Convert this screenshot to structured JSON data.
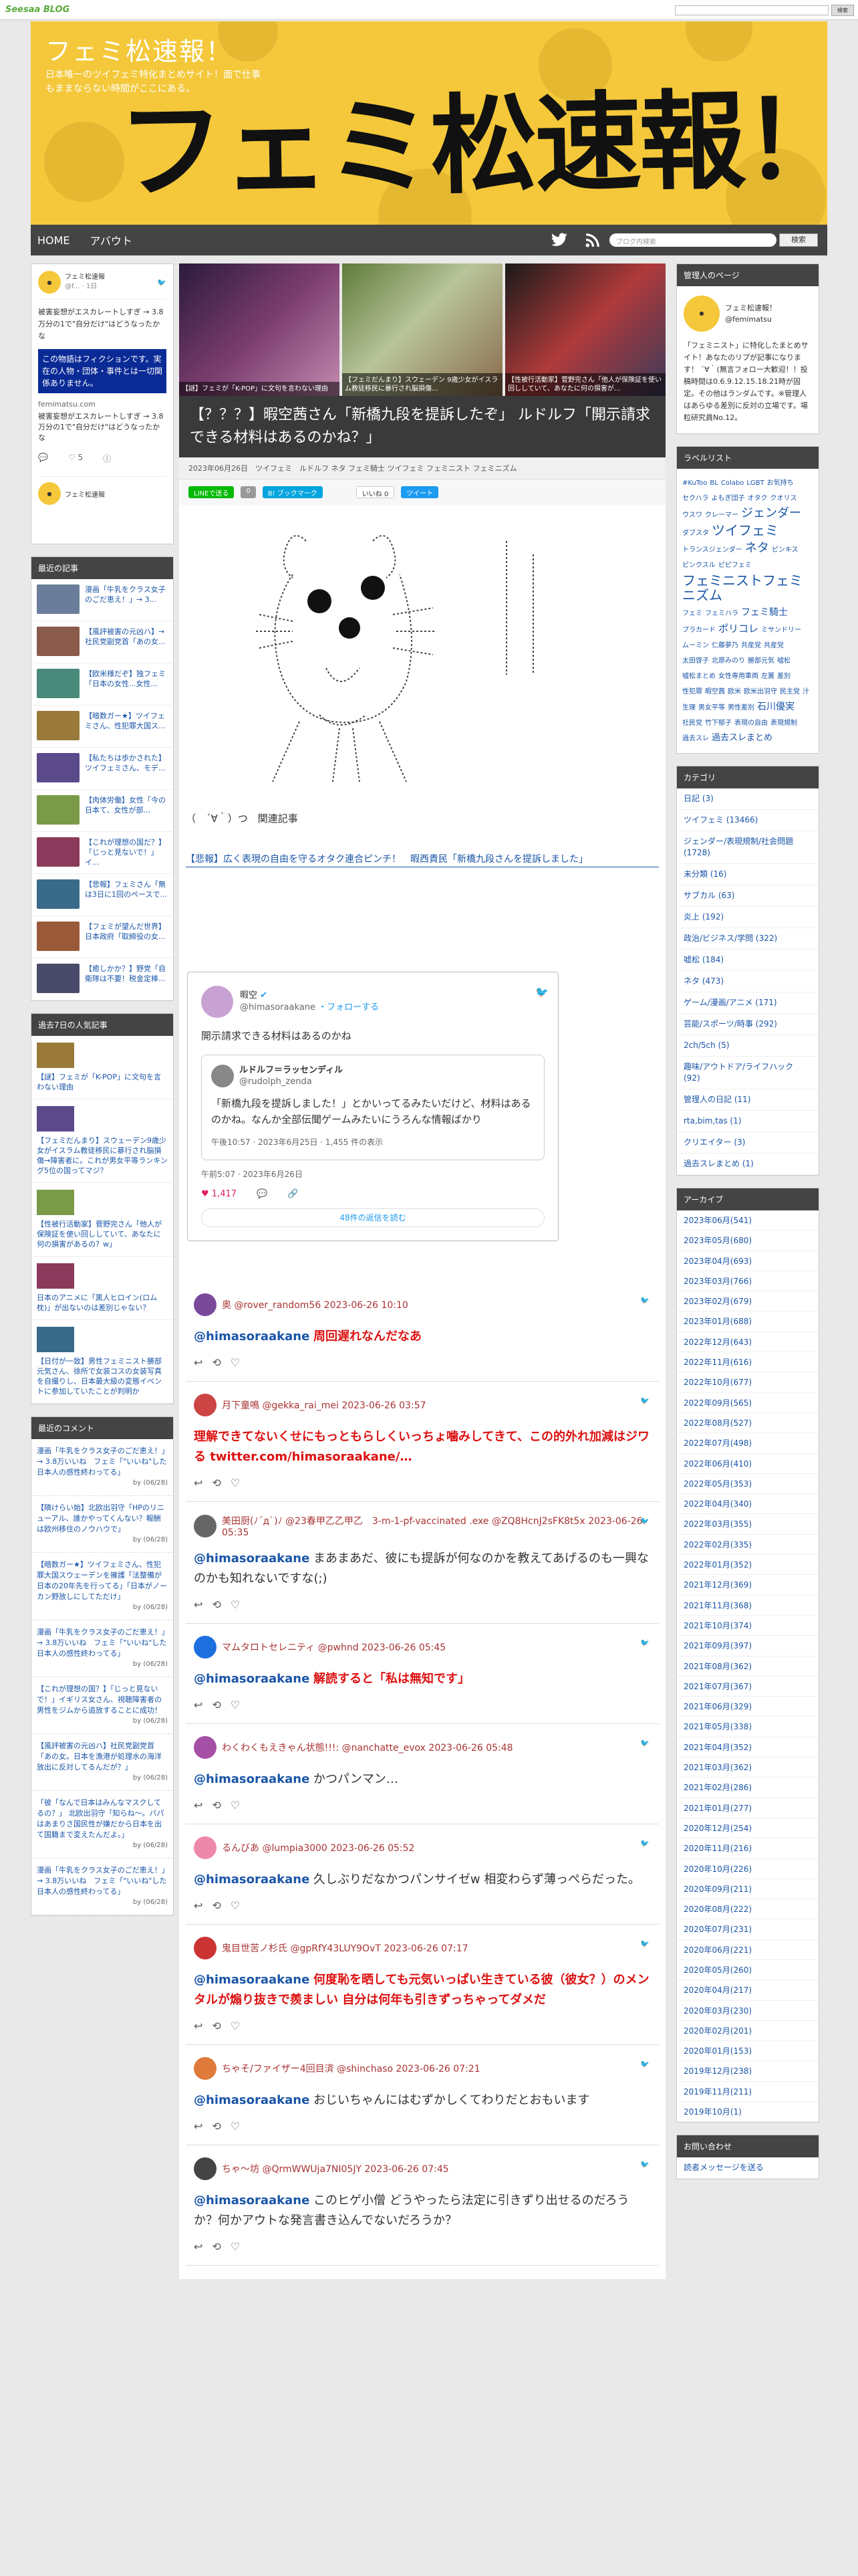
{
  "topbar": {
    "logo": "Seesaa",
    "logo_blog": "BLOG",
    "search_button": "検索"
  },
  "header": {
    "title": "フェミ松速報！",
    "description": "日本唯一のツイフェミ特化まとめサイト！面で仕事もままならない時間がここにある。",
    "logo_text": "フェミ松速報！"
  },
  "nav": {
    "items": [
      "HOME",
      "アバウト"
    ],
    "search_placeholder": "ブログ内検索",
    "search_button": "検索"
  },
  "left_twitter": {
    "name": "フェミ松速報",
    "meta": "@f... · 1日",
    "text": "被害妄想がエスカレートしすぎ → 3.8万分の1で\"自分だけ\"はどうなったかな",
    "banner": "この物語はフィクションです。実在の人物・団体・事件とは一切関係ありません。",
    "link": "femimatsu.com",
    "link_text": "被害妄想がエスカレートしすぎ → 3.8万分の1で\"自分だけ\"はどうなったかな",
    "likes": "5"
  },
  "recent": {
    "title": "最近の記事",
    "items": [
      "漫画「牛乳をクラス女子のごだ恵え！」→ 3...",
      "【風評被害の元凶ハ】→社民党副党首「あの女...",
      "【欧米様だぞ】独フェミ「日本の女性...女性...",
      "【暗数ガー★】ツイフェミさん、性犯罪大国ス...",
      "【私たちは歩かされた】ツイフェミさん、モデ...",
      "【肉体労働】女性「今の日本て、女性が部...",
      "【これが理想の国だ？】「じっと見ないで！」イ...",
      "【悲報】フェミさん「無は3日に1回のペースで...",
      "【フェミが望んだ世界】日本政府「取締役の女...",
      "【癒しかか？】野党「自衛隊は不要！税金定棒..."
    ]
  },
  "popular": {
    "title": "過去7日の人気記事",
    "items": [
      "【謎】フェミが「K-POP」に文句を言わない理由",
      "【フェミだんまり】スウェーデン9歳少女がイスラム教徒移民に暴行され脳損傷→障害者に。これが男女平等ランキング5位の国ってマジ？",
      "【性被行活動家】菅野完さん「他人が保険証を使い回ししていて、あなたに何の損害があるの？w」",
      "日本のアニメに「黒人ヒロイン(ロム枕)」が出ないのは差別じゃない？",
      "【日付が一致】男性フェミニスト勝部元気さん、徐所で女装コスの女装写真を自撮りし、日本最大級の変態イベントに参加していたことが判明か"
    ]
  },
  "comments": {
    "title": "最近のコメント",
    "items": [
      {
        "text": "漫画「牛乳をクラス女子のごだ恵え！」→ 3.8万いいね　フェミ「\"いいね\"した日本人の感性終わってる」",
        "by": "by (06/28)"
      },
      {
        "text": "【隣けらい始】北欧出羽守「HPのリニューアル、誰かやってくんない？報酬は欧州移住のノウハウで」",
        "by": "by (06/28)"
      },
      {
        "text": "【暗数ガー★】ツイフェミさん、性犯罪大国スウェーデンを擁護「法整備が日本の20年先を行ってる」「日本がノーカン野放しにしてただけ」",
        "by": "by (06/28)"
      },
      {
        "text": "漫画「牛乳をクラス女子のごだ恵え！」→ 3.8万いいね　フェミ「\"いいね\"した日本人の感性終わってる」",
        "by": "by (06/28)"
      },
      {
        "text": "【これが理想の国？】「じっと見ないで！」イギリス女さん、視聴障害者の男性をジムから追放することに成功！",
        "by": "by (06/28)"
      },
      {
        "text": "【風評被害の元凶ハ】社民党副党首「あの女。日本を漁港が処理水の海洋放出に反対してるんだが？」",
        "by": "by (06/28)"
      },
      {
        "text": "「彼「なんで日本はみんなマスクしてるの？」 北欧出羽守「知らね～。バパはあまりさ国民性が嫌だから日本を出て国籍まで変えたんだよ。」",
        "by": "by (06/28)"
      },
      {
        "text": "漫画「牛乳をクラス女子のごだ恵え！」→ 3.8万いいね　フェミ「\"いいね\"した日本人の感性終わってる」",
        "by": "by (06/28)"
      }
    ]
  },
  "featured": [
    "【謎】フェミが「K-POP」に文句を言わない理由",
    "【フェミだんまり】スウェーデン 9歳少女がイスラム教徒移民に暴行され脳損傷…",
    "【性被行活動家】菅野完さん「他人が保険証を使い回ししていて、あなたに何の損害が…"
  ],
  "post": {
    "title": "【？？？】暇空茜さん「新橋九段を提訴したぞ」 ルドルフ「開示請求できる材料はあるのかね？」",
    "meta": "2023年06月26日　ツイフェミ　ルドルフ ネタ フェミ騎士 ツイフェミ フェミニスト フェミニズム",
    "share": [
      "LINEで送る",
      "0",
      "B! ブックマーク",
      "0",
      "いいね 0",
      "ツイート"
    ],
    "related_label": "（　´∀｀）つ　関連記事",
    "related_link": "【悲報】広く表現の自由を守るオタク連合ピンチ！　暇西貴民「新橋九段さんを提訴しました」",
    "embed": {
      "name": "暇空",
      "handle": "@himasoraakane",
      "follow": "・フォローする",
      "text": "開示請求できる材料はあるのかね",
      "quoted_name": "ルドルフ＝ラッセンディル",
      "quoted_handle": "@rudolph_zenda",
      "quoted_text": "「新橋九段を提訴しました！」とかいってるみたいだけど、材料はあるのかね。なんか全部伝聞ゲームみたいにうろんな情報ばかり",
      "quoted_time": "午後10:57 · 2023年6月25日 · 1,455 件の表示",
      "time": "午前5:07 · 2023年6月26日",
      "likes": "1,417",
      "more": "48件の返信を読む"
    },
    "replies": [
      {
        "user": "奥 @rover_random56 2023-06-26 10:10",
        "mention": "@himasoraakane",
        "text": "周回遅れなんだなあ",
        "red": true
      },
      {
        "user": "月下童鳴 @gekka_rai_mei 2023-06-26 03:57",
        "mention": "",
        "text": "理解できてないくせにもっともらしくいっちょ噛みしてきて、この的外れ加減はジワる twitter.com/himasoraakane/…",
        "red": true
      },
      {
        "user": "美田厨(ﾉ´д`)ﾉ @23春甲乙乙甲乙　3-m-1-pf-vaccinated .exe @ZQ8HcnJ2sFK8t5x 2023-06-26 05:35",
        "mention": "@himasoraakane",
        "text": "まあまあだ、彼にも提訴が何なのかを教えてあげるのも一興なのかも知れないですな(;)",
        "red": false
      },
      {
        "user": "マムタロトセレニティ @pwhnd 2023-06-26 05:45",
        "mention": "@himasoraakane",
        "text": "解読すると「私は無知です」",
        "red": true
      },
      {
        "user": "わくわくもえきゃん状態!!!: @nanchatte_evox 2023-06-26 05:48",
        "mention": "@himasoraakane",
        "text": "かつパンマン…",
        "red": false
      },
      {
        "user": "るんびあ @lumpia3000 2023-06-26 05:52",
        "mention": "@himasoraakane",
        "text": "久しぶりだなかつパンサイゼw 相変わらず薄っぺらだった。",
        "red": false
      },
      {
        "user": "鬼目世苦ノ杉氏 @gpRfY43LUY9OvT 2023-06-26 07:17",
        "mention": "@himasoraakane",
        "text": "何度恥を晒しても元気いっぱい生きている彼（彼女？）のメンタルが煽り抜きで羨ましい 自分は何年も引きずっちゃってダメだ",
        "red": true
      },
      {
        "user": "ちゃそ/ファイザー4回目済 @shinchaso 2023-06-26 07:21",
        "mention": "@himasoraakane",
        "text": "おじいちゃんにはむずかしくてわりだとおもいます",
        "red": false
      },
      {
        "user": "ちゃ〜坊 @QrmWWUja7NI05JY 2023-06-26 07:45",
        "mention": "@himasoraakane",
        "text": "このヒゲ小僧 どうやったら法定に引きずり出せるのだろうか？何かアウトな発言書き込んでないだろうか？",
        "red": false
      }
    ]
  },
  "profile": {
    "title": "管理人のページ",
    "name": "フェミ松速報！",
    "handle": "@femimatsu",
    "text": "「フェミニスト」に特化したまとめサイト！あなたのリプが記事になります！ ´∀｀(無言フォロー大歓迎！！投稿時間は0.6.9.12.15.18.21時が固定。その他はランダムです。※管理人はあらゆる差別に反対の立場です。場粒研究員No.12。"
  },
  "tags": {
    "title": "ラベルリスト",
    "items": [
      "#KuToo",
      "BL",
      "Colabo",
      "LGBT",
      "お気持ち",
      "セクハラ",
      "よもぎ団子",
      "オタク",
      "クオリス",
      "ウスワ",
      "クレーマー",
      "ジェンダー",
      "ダブスタ",
      "ツイフェミ",
      "トランスジェンダー",
      "ネタ",
      "ピンキス",
      "ピンクスル",
      "ピピフェミ",
      "フェミニストフェミニズム",
      "フェミ",
      "フェミハラ",
      "フェミ騎士",
      "プラカード",
      "ポリコレ",
      "ミサンドリー",
      "ムーミン",
      "仁藤夢乃",
      "共産党",
      "共産党",
      "太田啓子",
      "北原みのり",
      "勝部元気",
      "嘘松",
      "嘘松まとめ",
      "女性専用車両",
      "左翼",
      "差別",
      "性犯罪",
      "暇空茜",
      "欧米",
      "欧米出羽守",
      "民主党",
      "汁",
      "生理",
      "男女平等",
      "男性差別",
      "石川優実",
      "社民党",
      "竹下郁子",
      "表現の自由",
      "表現規制",
      "過去スレ",
      "過去スレまとめ"
    ]
  },
  "categories": {
    "title": "カテゴリ",
    "items": [
      "日記 (3)",
      "ツイフェミ (13466)",
      "ジェンダー/表現規制/社会問題 (1728)",
      "未分類 (16)",
      "サブカル (63)",
      "炎上 (192)",
      "政治/ビジネス/学問 (322)",
      "嘘松 (184)",
      "ネタ (473)",
      "ゲーム/漫画/アニメ (171)",
      "芸能/スポーツ/時事 (292)",
      "2ch/5ch (5)",
      "趣味/アウトドア/ライフハック (92)",
      "管理人の日記 (11)",
      "rta,bim,tas (1)",
      "クリエイター (3)",
      "過去スレまとめ (1)"
    ]
  },
  "archive": {
    "title": "アーカイブ",
    "items": [
      "2023年06月(541)",
      "2023年05月(680)",
      "2023年04月(693)",
      "2023年03月(766)",
      "2023年02月(679)",
      "2023年01月(688)",
      "2022年12月(643)",
      "2022年11月(616)",
      "2022年10月(677)",
      "2022年09月(565)",
      "2022年08月(527)",
      "2022年07月(498)",
      "2022年06月(410)",
      "2022年05月(353)",
      "2022年04月(340)",
      "2022年03月(355)",
      "2022年02月(335)",
      "2022年01月(352)",
      "2021年12月(369)",
      "2021年11月(368)",
      "2021年10月(374)",
      "2021年09月(397)",
      "2021年08月(362)",
      "2021年07月(367)",
      "2021年06月(329)",
      "2021年05月(338)",
      "2021年04月(352)",
      "2021年03月(362)",
      "2021年02月(286)",
      "2021年01月(277)",
      "2020年12月(254)",
      "2020年11月(216)",
      "2020年10月(226)",
      "2020年09月(211)",
      "2020年08月(222)",
      "2020年07月(231)",
      "2020年06月(221)",
      "2020年05月(260)",
      "2020年04月(217)",
      "2020年03月(230)",
      "2020年02月(201)",
      "2020年01月(153)",
      "2019年12月(238)",
      "2019年11月(211)",
      "2019年10月(1)"
    ]
  },
  "contact": {
    "title": "お問い合わせ",
    "link": "読者メッセージを送る"
  }
}
